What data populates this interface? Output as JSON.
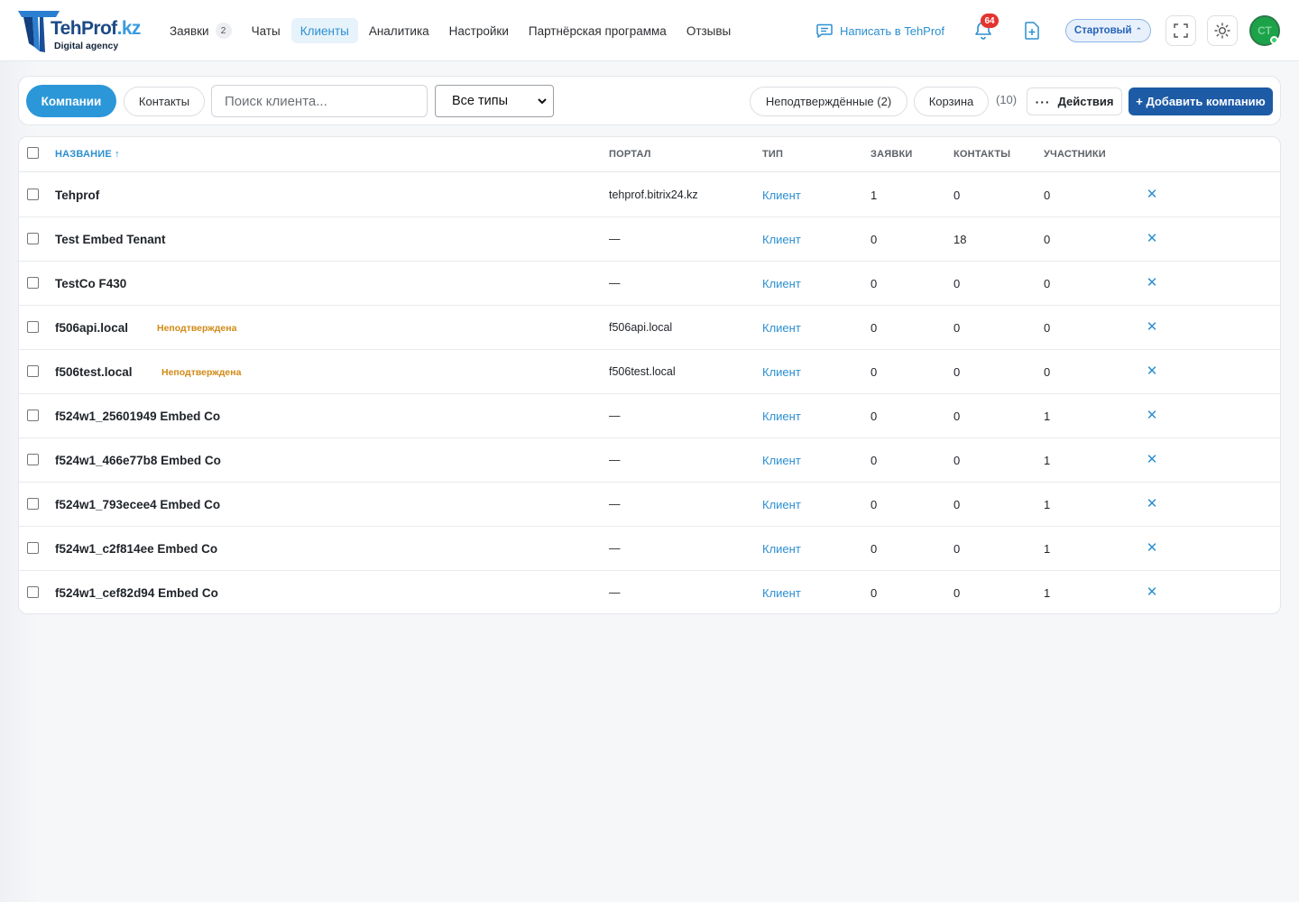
{
  "header": {
    "logo": {
      "name_main": "TehProf",
      "name_suffix": ".kz",
      "tagline": "Digital agency"
    },
    "nav": [
      {
        "label": "Заявки",
        "badge": "2",
        "active": false
      },
      {
        "label": "Чаты",
        "active": false
      },
      {
        "label": "Клиенты",
        "active": true
      },
      {
        "label": "Аналитика",
        "active": false
      },
      {
        "label": "Настройки",
        "active": false
      },
      {
        "label": "Партнёрская программа",
        "active": false
      },
      {
        "label": "Отзывы",
        "active": false
      }
    ],
    "write_link": "Написать в TehProf",
    "notifications_count": "64",
    "plan": "Стартовый",
    "avatar_initials": "СТ"
  },
  "toolbar": {
    "tab_companies": "Компании",
    "tab_contacts": "Контакты",
    "search_placeholder": "Поиск клиента...",
    "type_filter": "Все типы",
    "unconfirmed": "Неподтверждённые (2)",
    "trash": "Корзина",
    "count": "(10)",
    "actions": "Действия",
    "add_company": "+ Добавить компанию"
  },
  "table": {
    "columns": {
      "name": "НАЗВАНИЕ ↑",
      "portal": "ПОРТАЛ",
      "type": "ТИП",
      "requests": "ЗАЯВКИ",
      "contacts": "КОНТАКТЫ",
      "members": "УЧАСТНИКИ"
    },
    "rows": [
      {
        "name": "Tehprof",
        "badge": "",
        "portal": "tehprof.bitrix24.kz",
        "type": "Клиент",
        "requests": "1",
        "contacts": "0",
        "members": "0"
      },
      {
        "name": "Test Embed Tenant",
        "badge": "",
        "portal": "—",
        "type": "Клиент",
        "requests": "0",
        "contacts": "18",
        "members": "0"
      },
      {
        "name": "TestCo F430",
        "badge": "",
        "portal": "—",
        "type": "Клиент",
        "requests": "0",
        "contacts": "0",
        "members": "0"
      },
      {
        "name": "f506api.local",
        "badge": "Неподтверждена",
        "portal": "f506api.local",
        "type": "Клиент",
        "requests": "0",
        "contacts": "0",
        "members": "0"
      },
      {
        "name": "f506test.local",
        "badge": "Неподтверждена",
        "portal": "f506test.local",
        "type": "Клиент",
        "requests": "0",
        "contacts": "0",
        "members": "0"
      },
      {
        "name": "f524w1_25601949 Embed Co",
        "badge": "",
        "portal": "—",
        "type": "Клиент",
        "requests": "0",
        "contacts": "0",
        "members": "1"
      },
      {
        "name": "f524w1_466e77b8 Embed Co",
        "badge": "",
        "portal": "—",
        "type": "Клиент",
        "requests": "0",
        "contacts": "0",
        "members": "1"
      },
      {
        "name": "f524w1_793ecee4 Embed Co",
        "badge": "",
        "portal": "—",
        "type": "Клиент",
        "requests": "0",
        "contacts": "0",
        "members": "1"
      },
      {
        "name": "f524w1_c2f814ee Embed Co",
        "badge": "",
        "portal": "—",
        "type": "Клиент",
        "requests": "0",
        "contacts": "0",
        "members": "1"
      },
      {
        "name": "f524w1_cef82d94 Embed Co",
        "badge": "",
        "portal": "—",
        "type": "Клиент",
        "requests": "0",
        "contacts": "0",
        "members": "1"
      }
    ]
  },
  "colors": {
    "accent": "#2b97d8",
    "primary_button": "#1d5ba6",
    "badge_red": "#e2342f",
    "unconfirmed": "#d18a16",
    "avatar": "#1ca34a"
  },
  "icons": [
    "chat-icon",
    "bell-icon",
    "file-plus-icon",
    "fullscreen-icon",
    "sun-icon",
    "dots-icon",
    "close-icon",
    "chevron-down-icon"
  ]
}
